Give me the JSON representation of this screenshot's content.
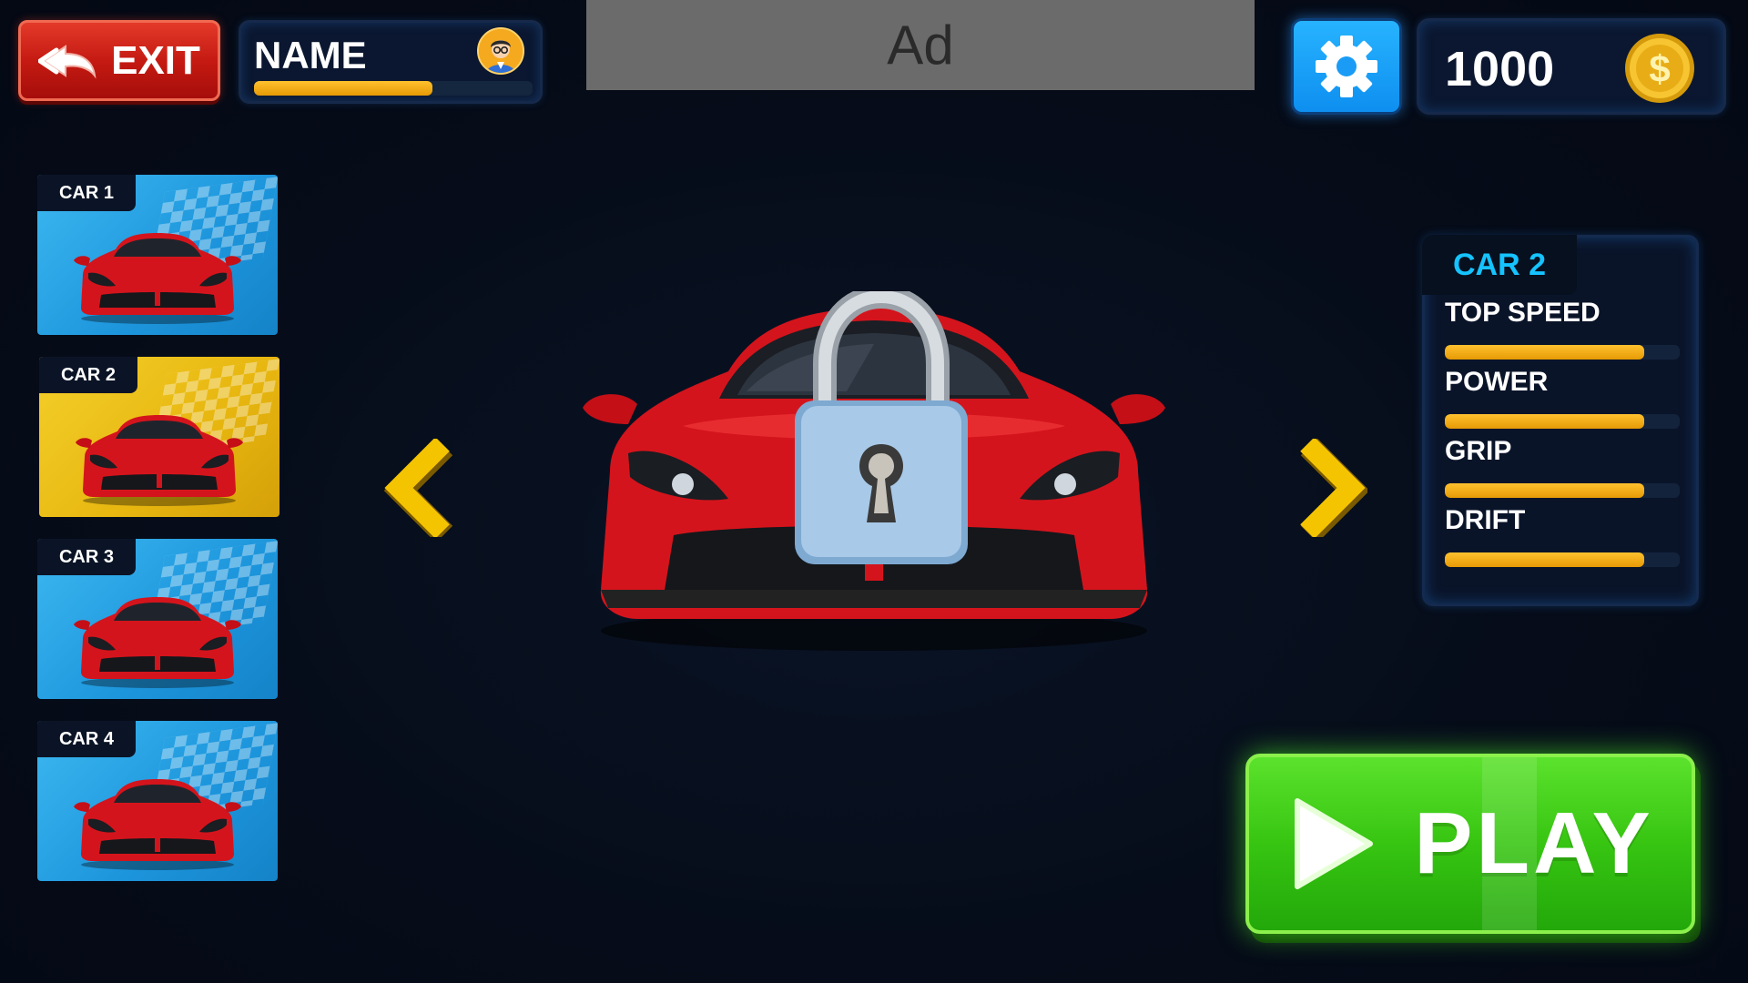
{
  "header": {
    "exit_label": "EXIT",
    "player_name": "NAME",
    "xp_fraction": 0.64,
    "ad_text": "Ad",
    "coins": "1000"
  },
  "car_list": [
    {
      "label": "CAR 1",
      "theme": "blue"
    },
    {
      "label": "CAR 2",
      "theme": "yellow",
      "selected": true
    },
    {
      "label": "CAR 3",
      "theme": "blue"
    },
    {
      "label": "CAR 4",
      "theme": "blue"
    }
  ],
  "selected_car": {
    "name": "CAR 2",
    "locked": true,
    "stats": [
      {
        "label": "TOP SPEED",
        "value": 0.85
      },
      {
        "label": "POWER",
        "value": 0.85
      },
      {
        "label": "GRIP",
        "value": 0.85
      },
      {
        "label": "DRIFT",
        "value": 0.85
      }
    ]
  },
  "play_label": "PLAY",
  "colors": {
    "background": "#050b18",
    "accent_yellow": "#f5c400",
    "stat_fill": "#f0a90c",
    "play_green": "#37c512",
    "settings_blue": "#1aa3ff",
    "exit_red": "#c51a12"
  },
  "icons": {
    "exit": "back-arrow-icon",
    "settings": "gear-icon",
    "coin": "dollar-coin-icon",
    "lock": "padlock-icon",
    "prev": "chevron-left-icon",
    "next": "chevron-right-icon",
    "play": "play-triangle-icon"
  }
}
